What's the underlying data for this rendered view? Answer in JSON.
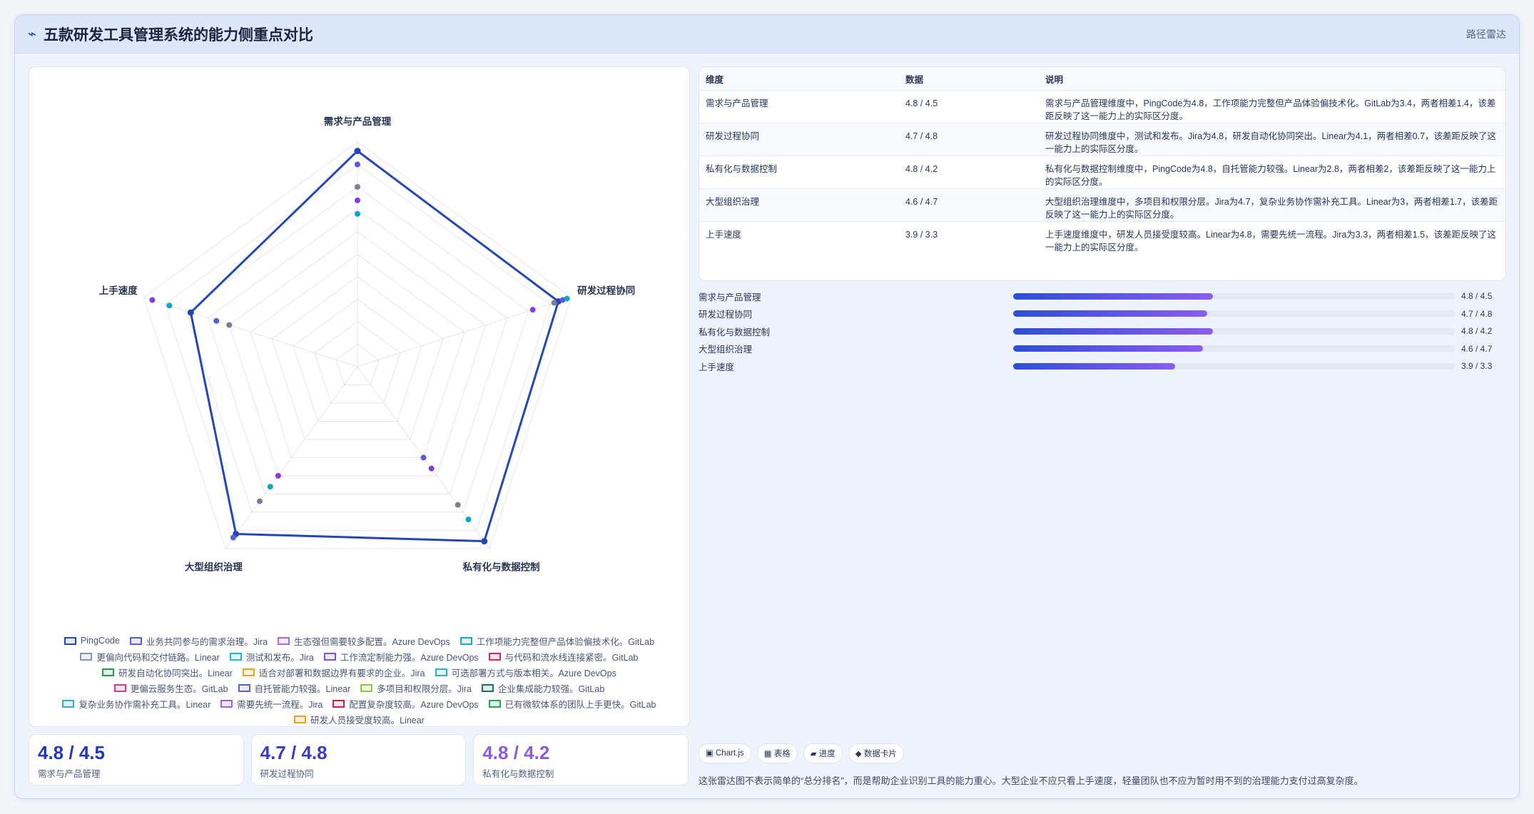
{
  "header": {
    "icon": "⌁",
    "icon_name": "trend-line-icon",
    "title": "五款研发工具管理系统的能力侧重点对比",
    "type_label": "路径雷达"
  },
  "chart_data": {
    "type": "radar",
    "title": "",
    "axes": [
      "需求与产品管理",
      "研发过程协同",
      "私有化与数据控制",
      "大型组织治理",
      "上手速度"
    ],
    "range": [
      0,
      5
    ],
    "grid": true,
    "legend_position": "bottom",
    "series": [
      {
        "name": "PingCode",
        "color": "#2447b6",
        "values": [
          4.8,
          4.7,
          4.8,
          4.6,
          3.9
        ]
      },
      {
        "name": "业务共同参与的需求治理。Jira",
        "color": "#5b5bd6",
        "values": [
          4.5,
          4.8,
          2.5,
          4.7,
          3.3
        ]
      },
      {
        "name": "生态强但需要较多配置。Azure DevOps",
        "color": "#7c7c92",
        "values": [
          4.0,
          4.6,
          3.8,
          3.7,
          3.0
        ]
      },
      {
        "name": "工作项能力完整但产品体验偏技术化。GitLab",
        "color": "#0fa5c9",
        "values": [
          3.4,
          4.9,
          4.2,
          3.3,
          4.4
        ]
      },
      {
        "name": "更偏向代码和交付链路。Linear",
        "color": "#8a3be0",
        "values": [
          3.7,
          4.1,
          2.8,
          3.0,
          4.8
        ]
      }
    ]
  },
  "legend": [
    {
      "label": "PingCode",
      "color": "#2447b6"
    },
    {
      "label": "业务共同参与的需求治理。Jira",
      "color": "#5b5bd6"
    },
    {
      "label": "生态强但需要较多配置。Azure DevOps",
      "color": "#a56ee0"
    },
    {
      "label": "工作项能力完整但产品体验偏技术化。GitLab",
      "color": "#1aa9c9"
    },
    {
      "label": "更偏向代码和交付链路。Linear",
      "color": "#8a96ad"
    },
    {
      "label": "测试和发布。Jira",
      "color": "#26b3cf"
    },
    {
      "label": "工作流定制能力强。Azure DevOps",
      "color": "#7b53d8"
    },
    {
      "label": "与代码和流水线连接紧密。GitLab",
      "color": "#d22e55"
    },
    {
      "label": "研发自动化协同突出。Linear",
      "color": "#1e9e55"
    },
    {
      "label": "适合对部署和数据边界有要求的企业。Jira",
      "color": "#f0a020"
    },
    {
      "label": "可选部署方式与版本相关。Azure DevOps",
      "color": "#2aaecf"
    },
    {
      "label": "更偏云服务生态。GitLab",
      "color": "#d83889"
    },
    {
      "label": "自托管能力较强。Linear",
      "color": "#5b5fd6"
    },
    {
      "label": "多项目和权限分层。Jira",
      "color": "#8fcc3a"
    },
    {
      "label": "企业集成能力较强。GitLab",
      "color": "#1c6f5e"
    },
    {
      "label": "复杂业务协作需补充工具。Linear",
      "color": "#29b1d4"
    },
    {
      "label": "需要先统一流程。Jira",
      "color": "#9a62e0"
    },
    {
      "label": "配置复杂度较高。Azure DevOps",
      "color": "#c8244f"
    },
    {
      "label": "已有微软体系的团队上手更快。GitLab",
      "color": "#22a35a"
    },
    {
      "label": "研发人员接受度较高。Linear",
      "color": "#f0a020"
    }
  ],
  "kpis": [
    {
      "value": "4.8 / 4.5",
      "label": "需求与产品管理",
      "color": "#2238b8"
    },
    {
      "value": "4.7 / 4.8",
      "label": "研发过程协同",
      "color": "#3a3cc4"
    },
    {
      "value": "4.8 / 4.2",
      "label": "私有化与数据控制",
      "color": "#8a5ae6"
    }
  ],
  "table": {
    "headers": [
      "维度",
      "数据",
      "说明"
    ],
    "rows": [
      [
        "需求与产品管理",
        "4.8 / 4.5",
        "需求与产品管理维度中，PingCode为4.8，工作项能力完整但产品体验偏技术化。GitLab为3.4，两者相差1.4，该差距反映了这一能力上的实际区分度。"
      ],
      [
        "研发过程协同",
        "4.7 / 4.8",
        "研发过程协同维度中，测试和发布。Jira为4.8，研发自动化协同突出。Linear为4.1，两者相差0.7，该差距反映了这一能力上的实际区分度。"
      ],
      [
        "私有化与数据控制",
        "4.8 / 4.2",
        "私有化与数据控制维度中，PingCode为4.8，自托管能力较强。Linear为2.8，两者相差2，该差距反映了这一能力上的实际区分度。"
      ],
      [
        "大型组织治理",
        "4.6 / 4.7",
        "大型组织治理维度中，多项目和权限分层。Jira为4.7，复杂业务协作需补充工具。Linear为3，两者相差1.7，该差距反映了这一能力上的实际区分度。"
      ],
      [
        "上手速度",
        "3.9 / 3.3",
        "上手速度维度中，研发人员接受度较高。Linear为4.8，需要先统一流程。Jira为3.3，两者相差1.5，该差距反映了这一能力上的实际区分度。"
      ]
    ]
  },
  "progress": [
    {
      "label": "需求与产品管理",
      "value": "4.8 / 4.5",
      "fraction": 0.452
    },
    {
      "label": "研发过程协同",
      "value": "4.7 / 4.8",
      "fraction": 0.439
    },
    {
      "label": "私有化与数据控制",
      "value": "4.8 / 4.2",
      "fraction": 0.452
    },
    {
      "label": "大型组织治理",
      "value": "4.6 / 4.7",
      "fraction": 0.429
    },
    {
      "label": "上手速度",
      "value": "3.9 / 3.3",
      "fraction": 0.366
    }
  ],
  "chips": [
    "▣ Chart.js",
    "▦ 表格",
    "▰ 进度",
    "◆ 数据卡片"
  ],
  "note": "这张雷达图不表示简单的“总分排名”，而是帮助企业识别工具的能力重心。大型企业不应只看上手速度，轻量团队也不应为暂时用不到的治理能力支付过高复杂度。"
}
